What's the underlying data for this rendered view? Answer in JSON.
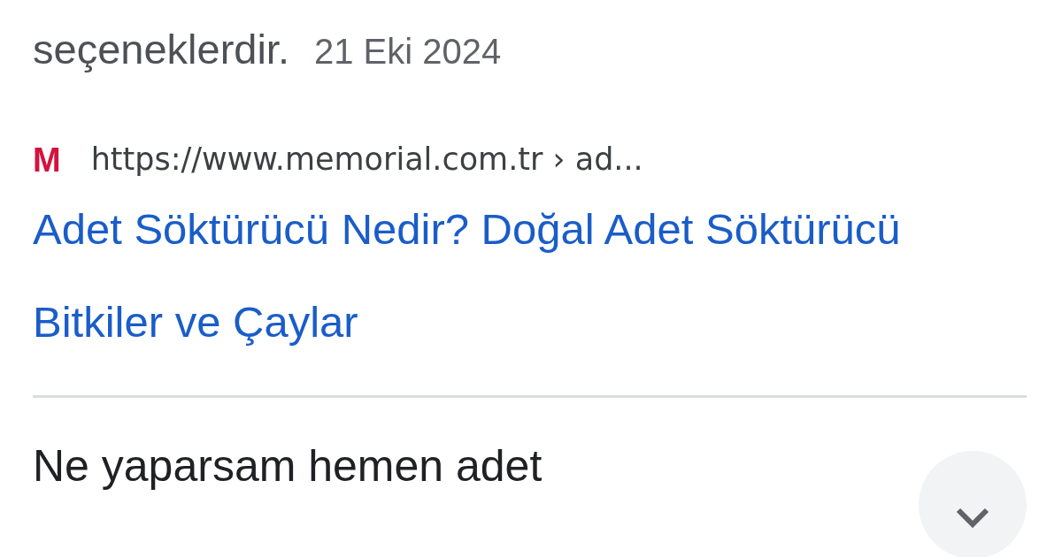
{
  "snippet": {
    "text": "seçeneklerdir.",
    "date": "21 Eki 2024"
  },
  "result": {
    "favicon": "M",
    "url": "https://www.memorial.com.tr › ad...",
    "title": "Adet Söktürücü Nedir? Doğal Adet Söktürücü Bitkiler ve Çaylar"
  },
  "question": {
    "text": "Ne yaparsam hemen adet",
    "expanded": false
  }
}
